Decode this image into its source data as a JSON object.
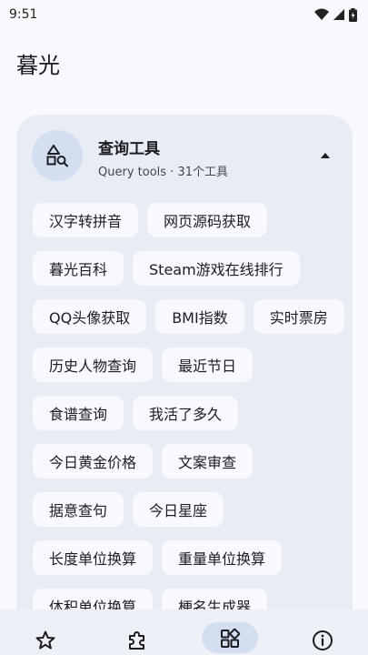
{
  "status_bar": {
    "time": "9:51",
    "icons": [
      "wifi-icon",
      "cellular-signal-icon",
      "battery-icon"
    ]
  },
  "app": {
    "title": "暮光"
  },
  "category": {
    "title": "查询工具",
    "subtitle": "Query tools · 31个工具",
    "icon": "shapes-search-icon",
    "expanded": true,
    "tools": [
      "汉字转拼音",
      "网页源码获取",
      "暮光百科",
      "Steam游戏在线排行",
      "QQ头像获取",
      "BMI指数",
      "实时票房",
      "历史人物查询",
      "最近节日",
      "食谱查询",
      "我活了多久",
      "今日黄金价格",
      "文案审查",
      "据意查句",
      "今日星座",
      "长度单位换算",
      "重量单位换算",
      "体积单位换算",
      "梗名生成器"
    ]
  },
  "bottom_nav": {
    "items": [
      {
        "icon": "star-icon",
        "active": false
      },
      {
        "icon": "puzzle-icon",
        "active": false
      },
      {
        "icon": "grid-apps-icon",
        "active": true
      },
      {
        "icon": "info-icon",
        "active": false
      }
    ]
  },
  "colors": {
    "background": "#f7f9fc",
    "card": "#e8edf5",
    "chip": "#f7f9fd",
    "accent_container": "#d4def1",
    "text": "#1c1d21"
  }
}
